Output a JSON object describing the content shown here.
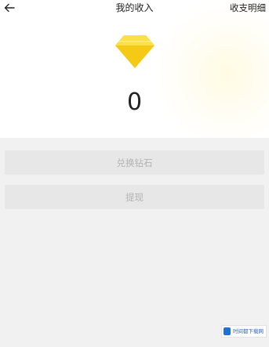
{
  "header": {
    "title": "我的收入",
    "detail_label": "收支明细",
    "back_icon": "arrow-left-icon"
  },
  "balance": {
    "icon": "diamond-icon",
    "value": "0"
  },
  "actions": {
    "exchange_label": "兑换钻石",
    "withdraw_label": "提现"
  },
  "watermark": {
    "text": "时间都下载网"
  },
  "colors": {
    "diamond": "#f7d21c",
    "button_bg": "#e7e7e7",
    "button_text": "#b2b2b2",
    "page_bg": "#f1f1f1"
  }
}
